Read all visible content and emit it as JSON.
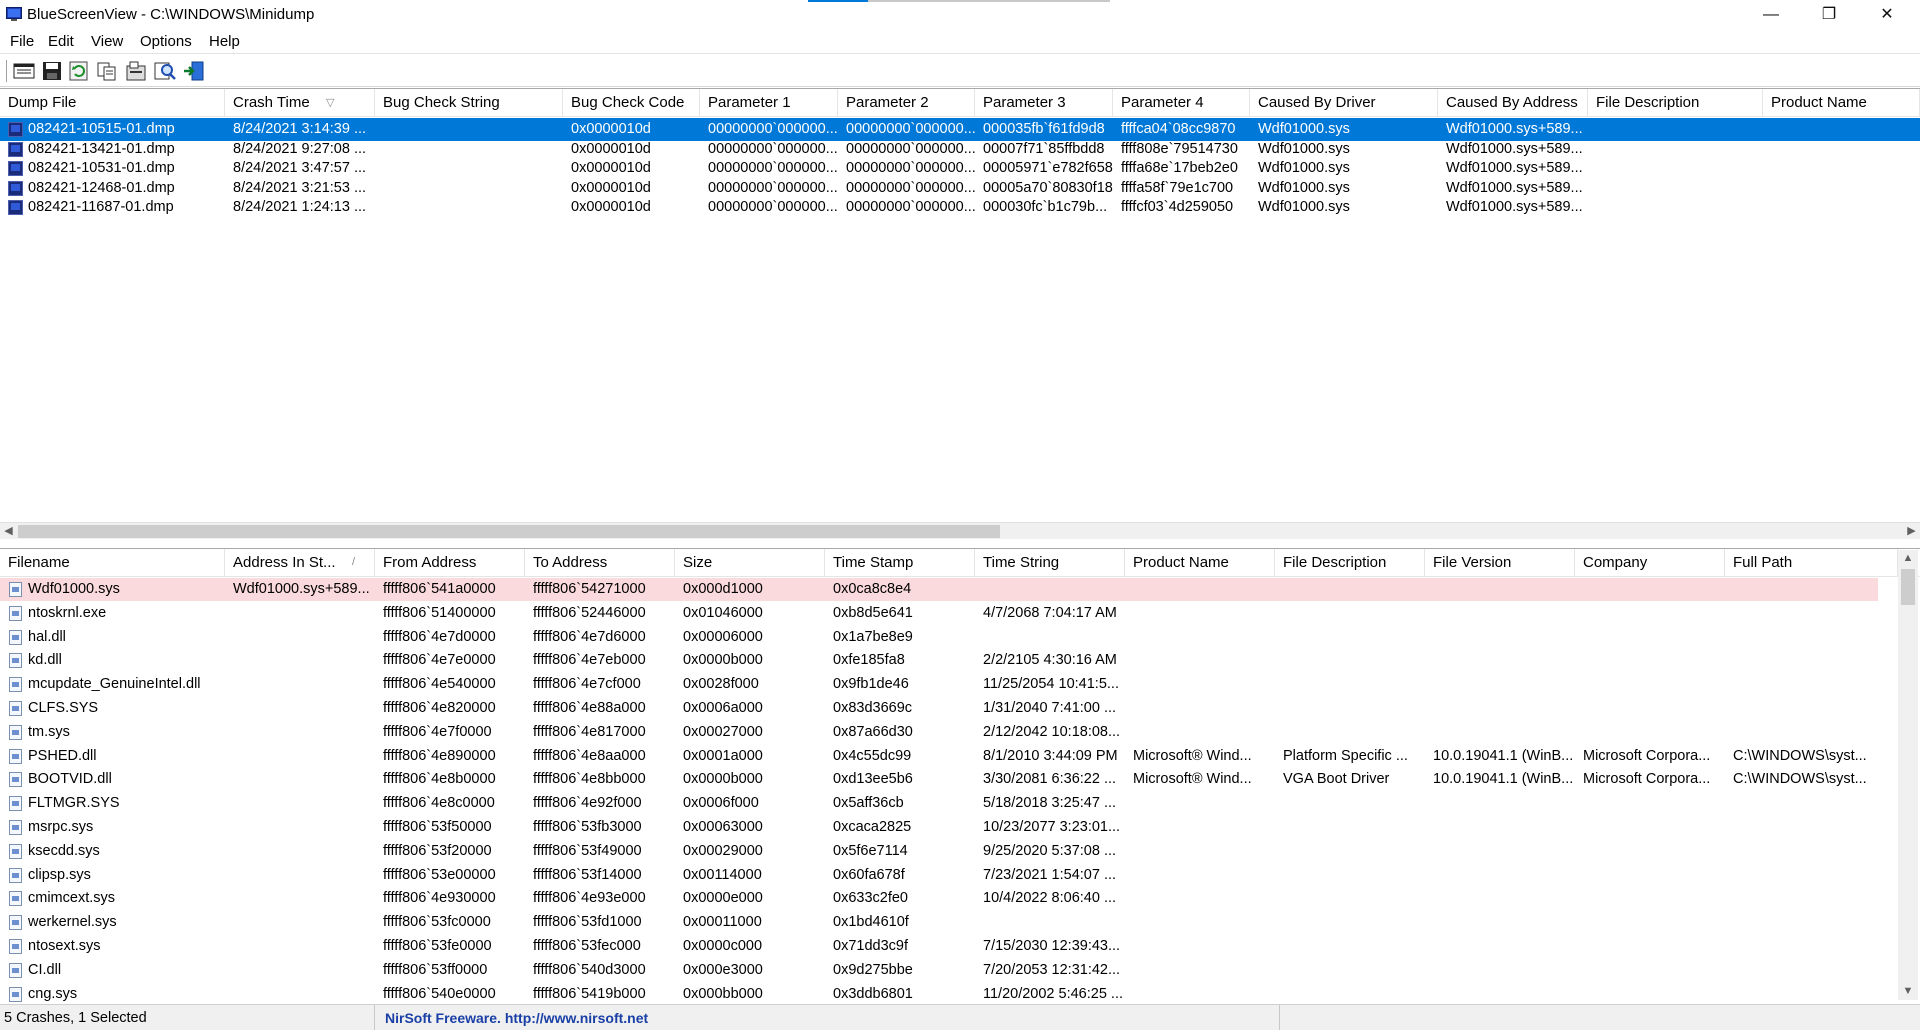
{
  "window": {
    "title": "BlueScreenView  -  C:\\WINDOWS\\Minidump",
    "minimize": "—",
    "restore": "❐",
    "close": "✕"
  },
  "menu": [
    "File",
    "Edit",
    "View",
    "Options",
    "Help"
  ],
  "toolbar": {
    "buttons": [
      "properties-icon",
      "save-icon",
      "refresh-icon",
      "copy-icon",
      "advanced-options-icon",
      "find-icon",
      "exit-icon"
    ]
  },
  "crashes": {
    "columns": [
      "Dump File",
      "Crash Time",
      "Bug Check String",
      "Bug Check Code",
      "Parameter 1",
      "Parameter 2",
      "Parameter 3",
      "Parameter 4",
      "Caused By Driver",
      "Caused By Address",
      "File Description",
      "Product Name"
    ],
    "sort_indicator": "▽",
    "rows": [
      [
        "082421-10515-01.dmp",
        "8/24/2021 3:14:39 ...",
        "",
        "0x0000010d",
        "00000000`000000...",
        "00000000`000000...",
        "000035fb`f61fd9d8",
        "ffffca04`08cc9870",
        "Wdf01000.sys",
        "Wdf01000.sys+589...",
        "",
        ""
      ],
      [
        "082421-13421-01.dmp",
        "8/24/2021 9:27:08 ...",
        "",
        "0x0000010d",
        "00000000`000000...",
        "00000000`000000...",
        "00007f71`85ffbdd8",
        "ffff808e`79514730",
        "Wdf01000.sys",
        "Wdf01000.sys+589...",
        "",
        ""
      ],
      [
        "082421-10531-01.dmp",
        "8/24/2021 3:47:57 ...",
        "",
        "0x0000010d",
        "00000000`000000...",
        "00000000`000000...",
        "00005971`e782f658",
        "ffffa68e`17beb2e0",
        "Wdf01000.sys",
        "Wdf01000.sys+589...",
        "",
        ""
      ],
      [
        "082421-12468-01.dmp",
        "8/24/2021 3:21:53 ...",
        "",
        "0x0000010d",
        "00000000`000000...",
        "00000000`000000...",
        "00005a70`80830f18",
        "ffffa58f`79e1c700",
        "Wdf01000.sys",
        "Wdf01000.sys+589...",
        "",
        ""
      ],
      [
        "082421-11687-01.dmp",
        "8/24/2021 1:24:13 ...",
        "",
        "0x0000010d",
        "00000000`000000...",
        "00000000`000000...",
        "000030fc`b1c79b...",
        "ffffcf03`4d259050",
        "Wdf01000.sys",
        "Wdf01000.sys+589...",
        "",
        ""
      ]
    ]
  },
  "drivers": {
    "columns": [
      "Filename",
      "Address In St...",
      "From Address",
      "To Address",
      "Size",
      "Time Stamp",
      "Time String",
      "Product Name",
      "File Description",
      "File Version",
      "Company",
      "Full Path"
    ],
    "sort_indicator": "/",
    "rows": [
      [
        "Wdf01000.sys",
        "Wdf01000.sys+589...",
        "fffff806`541a0000",
        "fffff806`54271000",
        "0x000d1000",
        "0x0ca8c8e4",
        "",
        "",
        "",
        "",
        "",
        ""
      ],
      [
        "ntoskrnl.exe",
        "",
        "fffff806`51400000",
        "fffff806`52446000",
        "0x01046000",
        "0xb8d5e641",
        "4/7/2068 7:04:17 AM",
        "",
        "",
        "",
        "",
        ""
      ],
      [
        "hal.dll",
        "",
        "fffff806`4e7d0000",
        "fffff806`4e7d6000",
        "0x00006000",
        "0x1a7be8e9",
        "",
        "",
        "",
        "",
        "",
        ""
      ],
      [
        "kd.dll",
        "",
        "fffff806`4e7e0000",
        "fffff806`4e7eb000",
        "0x0000b000",
        "0xfe185fa8",
        "2/2/2105 4:30:16 AM",
        "",
        "",
        "",
        "",
        ""
      ],
      [
        "mcupdate_GenuineIntel.dll",
        "",
        "fffff806`4e540000",
        "fffff806`4e7cf000",
        "0x0028f000",
        "0x9fb1de46",
        "11/25/2054 10:41:5...",
        "",
        "",
        "",
        "",
        ""
      ],
      [
        "CLFS.SYS",
        "",
        "fffff806`4e820000",
        "fffff806`4e88a000",
        "0x0006a000",
        "0x83d3669c",
        "1/31/2040 7:41:00 ...",
        "",
        "",
        "",
        "",
        ""
      ],
      [
        "tm.sys",
        "",
        "fffff806`4e7f0000",
        "fffff806`4e817000",
        "0x00027000",
        "0x87a66d30",
        "2/12/2042 10:18:08...",
        "",
        "",
        "",
        "",
        ""
      ],
      [
        "PSHED.dll",
        "",
        "fffff806`4e890000",
        "fffff806`4e8aa000",
        "0x0001a000",
        "0x4c55dc99",
        "8/1/2010 3:44:09 PM",
        "Microsoft® Wind...",
        "Platform Specific ...",
        "10.0.19041.1 (WinB...",
        "Microsoft Corpora...",
        "C:\\WINDOWS\\syst..."
      ],
      [
        "BOOTVID.dll",
        "",
        "fffff806`4e8b0000",
        "fffff806`4e8bb000",
        "0x0000b000",
        "0xd13ee5b6",
        "3/30/2081 6:36:22 ...",
        "Microsoft® Wind...",
        "VGA Boot Driver",
        "10.0.19041.1 (WinB...",
        "Microsoft Corpora...",
        "C:\\WINDOWS\\syst..."
      ],
      [
        "FLTMGR.SYS",
        "",
        "fffff806`4e8c0000",
        "fffff806`4e92f000",
        "0x0006f000",
        "0x5aff36cb",
        "5/18/2018 3:25:47 ...",
        "",
        "",
        "",
        "",
        ""
      ],
      [
        "msrpc.sys",
        "",
        "fffff806`53f50000",
        "fffff806`53fb3000",
        "0x00063000",
        "0xcaca2825",
        "10/23/2077 3:23:01...",
        "",
        "",
        "",
        "",
        ""
      ],
      [
        "ksecdd.sys",
        "",
        "fffff806`53f20000",
        "fffff806`53f49000",
        "0x00029000",
        "0x5f6e7114",
        "9/25/2020 5:37:08 ...",
        "",
        "",
        "",
        "",
        ""
      ],
      [
        "clipsp.sys",
        "",
        "fffff806`53e00000",
        "fffff806`53f14000",
        "0x00114000",
        "0x60fa678f",
        "7/23/2021 1:54:07 ...",
        "",
        "",
        "",
        "",
        ""
      ],
      [
        "cmimcext.sys",
        "",
        "fffff806`4e930000",
        "fffff806`4e93e000",
        "0x0000e000",
        "0x633c2fe0",
        "10/4/2022 8:06:40 ...",
        "",
        "",
        "",
        "",
        ""
      ],
      [
        "werkernel.sys",
        "",
        "fffff806`53fc0000",
        "fffff806`53fd1000",
        "0x00011000",
        "0x1bd4610f",
        "",
        "",
        "",
        "",
        "",
        ""
      ],
      [
        "ntosext.sys",
        "",
        "fffff806`53fe0000",
        "fffff806`53fec000",
        "0x0000c000",
        "0x71dd3c9f",
        "7/15/2030 12:39:43...",
        "",
        "",
        "",
        "",
        ""
      ],
      [
        "CI.dll",
        "",
        "fffff806`53ff0000",
        "fffff806`540d3000",
        "0x000e3000",
        "0x9d275bbe",
        "7/20/2053 12:31:42...",
        "",
        "",
        "",
        "",
        ""
      ],
      [
        "cng.sys",
        "",
        "fffff806`540e0000",
        "fffff806`5419b000",
        "0x000bb000",
        "0x3ddb6801",
        "11/20/2002 5:46:25 ...",
        "",
        "",
        "",
        "",
        ""
      ]
    ]
  },
  "statusbar": {
    "summary": "5 Crashes, 1 Selected",
    "link": "NirSoft Freeware.  http://www.nirsoft.net"
  },
  "colors": {
    "selection": "#0078d7",
    "highlight_row": "#fadadd",
    "link": "#1a3fa6"
  }
}
